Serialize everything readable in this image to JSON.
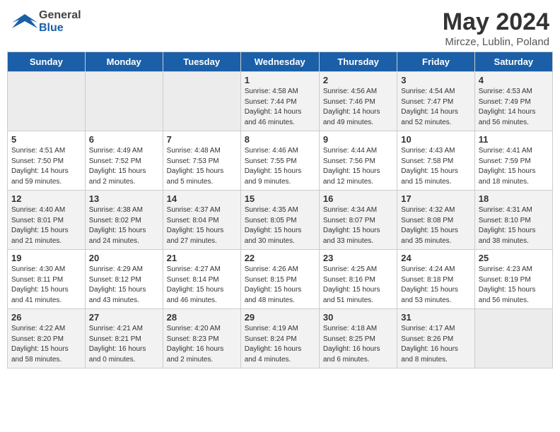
{
  "header": {
    "logo": {
      "general": "General",
      "blue": "Blue"
    },
    "title": "May 2024",
    "location": "Mircze, Lublin, Poland"
  },
  "days_of_week": [
    "Sunday",
    "Monday",
    "Tuesday",
    "Wednesday",
    "Thursday",
    "Friday",
    "Saturday"
  ],
  "weeks": [
    [
      {
        "day": "",
        "info": ""
      },
      {
        "day": "",
        "info": ""
      },
      {
        "day": "",
        "info": ""
      },
      {
        "day": "1",
        "info": "Sunrise: 4:58 AM\nSunset: 7:44 PM\nDaylight: 14 hours\nand 46 minutes."
      },
      {
        "day": "2",
        "info": "Sunrise: 4:56 AM\nSunset: 7:46 PM\nDaylight: 14 hours\nand 49 minutes."
      },
      {
        "day": "3",
        "info": "Sunrise: 4:54 AM\nSunset: 7:47 PM\nDaylight: 14 hours\nand 52 minutes."
      },
      {
        "day": "4",
        "info": "Sunrise: 4:53 AM\nSunset: 7:49 PM\nDaylight: 14 hours\nand 56 minutes."
      }
    ],
    [
      {
        "day": "5",
        "info": "Sunrise: 4:51 AM\nSunset: 7:50 PM\nDaylight: 14 hours\nand 59 minutes."
      },
      {
        "day": "6",
        "info": "Sunrise: 4:49 AM\nSunset: 7:52 PM\nDaylight: 15 hours\nand 2 minutes."
      },
      {
        "day": "7",
        "info": "Sunrise: 4:48 AM\nSunset: 7:53 PM\nDaylight: 15 hours\nand 5 minutes."
      },
      {
        "day": "8",
        "info": "Sunrise: 4:46 AM\nSunset: 7:55 PM\nDaylight: 15 hours\nand 9 minutes."
      },
      {
        "day": "9",
        "info": "Sunrise: 4:44 AM\nSunset: 7:56 PM\nDaylight: 15 hours\nand 12 minutes."
      },
      {
        "day": "10",
        "info": "Sunrise: 4:43 AM\nSunset: 7:58 PM\nDaylight: 15 hours\nand 15 minutes."
      },
      {
        "day": "11",
        "info": "Sunrise: 4:41 AM\nSunset: 7:59 PM\nDaylight: 15 hours\nand 18 minutes."
      }
    ],
    [
      {
        "day": "12",
        "info": "Sunrise: 4:40 AM\nSunset: 8:01 PM\nDaylight: 15 hours\nand 21 minutes."
      },
      {
        "day": "13",
        "info": "Sunrise: 4:38 AM\nSunset: 8:02 PM\nDaylight: 15 hours\nand 24 minutes."
      },
      {
        "day": "14",
        "info": "Sunrise: 4:37 AM\nSunset: 8:04 PM\nDaylight: 15 hours\nand 27 minutes."
      },
      {
        "day": "15",
        "info": "Sunrise: 4:35 AM\nSunset: 8:05 PM\nDaylight: 15 hours\nand 30 minutes."
      },
      {
        "day": "16",
        "info": "Sunrise: 4:34 AM\nSunset: 8:07 PM\nDaylight: 15 hours\nand 33 minutes."
      },
      {
        "day": "17",
        "info": "Sunrise: 4:32 AM\nSunset: 8:08 PM\nDaylight: 15 hours\nand 35 minutes."
      },
      {
        "day": "18",
        "info": "Sunrise: 4:31 AM\nSunset: 8:10 PM\nDaylight: 15 hours\nand 38 minutes."
      }
    ],
    [
      {
        "day": "19",
        "info": "Sunrise: 4:30 AM\nSunset: 8:11 PM\nDaylight: 15 hours\nand 41 minutes."
      },
      {
        "day": "20",
        "info": "Sunrise: 4:29 AM\nSunset: 8:12 PM\nDaylight: 15 hours\nand 43 minutes."
      },
      {
        "day": "21",
        "info": "Sunrise: 4:27 AM\nSunset: 8:14 PM\nDaylight: 15 hours\nand 46 minutes."
      },
      {
        "day": "22",
        "info": "Sunrise: 4:26 AM\nSunset: 8:15 PM\nDaylight: 15 hours\nand 48 minutes."
      },
      {
        "day": "23",
        "info": "Sunrise: 4:25 AM\nSunset: 8:16 PM\nDaylight: 15 hours\nand 51 minutes."
      },
      {
        "day": "24",
        "info": "Sunrise: 4:24 AM\nSunset: 8:18 PM\nDaylight: 15 hours\nand 53 minutes."
      },
      {
        "day": "25",
        "info": "Sunrise: 4:23 AM\nSunset: 8:19 PM\nDaylight: 15 hours\nand 56 minutes."
      }
    ],
    [
      {
        "day": "26",
        "info": "Sunrise: 4:22 AM\nSunset: 8:20 PM\nDaylight: 15 hours\nand 58 minutes."
      },
      {
        "day": "27",
        "info": "Sunrise: 4:21 AM\nSunset: 8:21 PM\nDaylight: 16 hours\nand 0 minutes."
      },
      {
        "day": "28",
        "info": "Sunrise: 4:20 AM\nSunset: 8:23 PM\nDaylight: 16 hours\nand 2 minutes."
      },
      {
        "day": "29",
        "info": "Sunrise: 4:19 AM\nSunset: 8:24 PM\nDaylight: 16 hours\nand 4 minutes."
      },
      {
        "day": "30",
        "info": "Sunrise: 4:18 AM\nSunset: 8:25 PM\nDaylight: 16 hours\nand 6 minutes."
      },
      {
        "day": "31",
        "info": "Sunrise: 4:17 AM\nSunset: 8:26 PM\nDaylight: 16 hours\nand 8 minutes."
      },
      {
        "day": "",
        "info": ""
      }
    ]
  ]
}
